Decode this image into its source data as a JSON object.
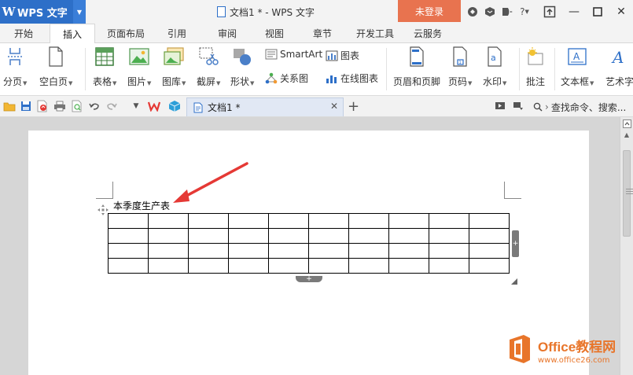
{
  "titlebar": {
    "app_name": "WPS 文字",
    "logo_letter": "W",
    "doc_title": "文档1 * - WPS 文字",
    "login_label": "未登录",
    "help_label": "?"
  },
  "tabs": [
    {
      "label": "开始"
    },
    {
      "label": "插入",
      "active": true
    },
    {
      "label": "页面布局"
    },
    {
      "label": "引用"
    },
    {
      "label": "审阅"
    },
    {
      "label": "视图"
    },
    {
      "label": "章节"
    },
    {
      "label": "开发工具"
    },
    {
      "label": "云服务"
    }
  ],
  "ribbon": {
    "page_break": "分页",
    "blank_page": "空白页",
    "table": "表格",
    "picture": "图片",
    "gallery": "图库",
    "screenshot": "截屏",
    "shapes": "形状",
    "smartart": "SmartArt",
    "chart": "图表",
    "relation_chart": "关系图",
    "online_chart": "在线图表",
    "header_footer": "页眉和页脚",
    "page_number": "页码",
    "watermark": "水印",
    "comment": "批注",
    "textbox": "文本框",
    "wordart": "艺术字"
  },
  "quickbar": {
    "doc_tab": "文档1 *",
    "search_placeholder": "查找命令、搜索..."
  },
  "document": {
    "heading": "本季度生产表",
    "table_rows": 4,
    "table_cols": 10
  },
  "watermark": {
    "brand": "Office教程网",
    "url": "www.office26.com"
  },
  "colors": {
    "app_blue": "#2d6fc8",
    "login_orange": "#e8734f",
    "annotation_red": "#e53935",
    "watermark_orange": "#e8752a"
  }
}
